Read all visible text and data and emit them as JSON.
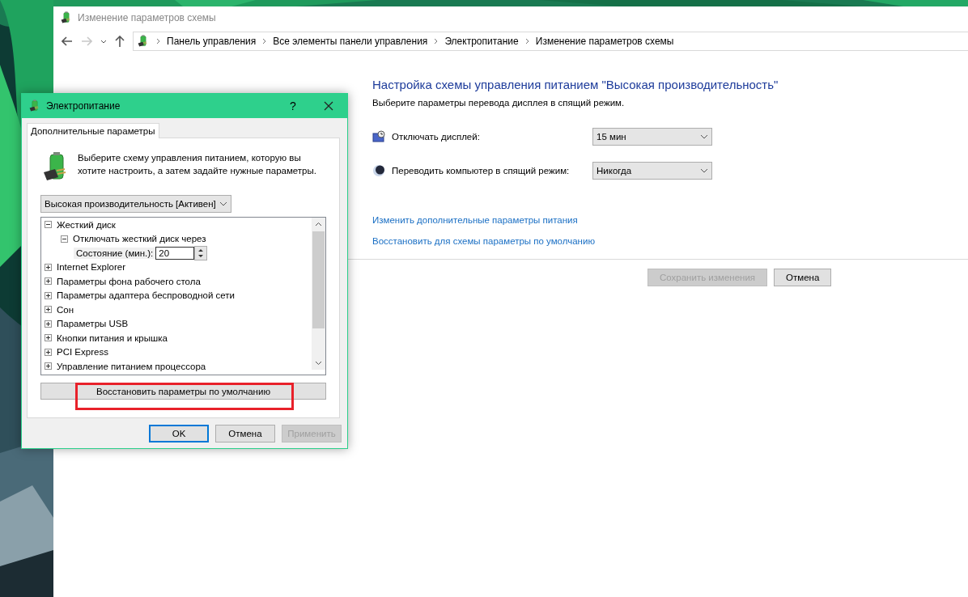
{
  "window": {
    "title": "Изменение параметров схемы"
  },
  "nav": [
    {
      "kind": "back",
      "disabled": false
    },
    {
      "kind": "forward",
      "disabled": true
    },
    {
      "kind": "recent",
      "disabled": false
    },
    {
      "kind": "up",
      "disabled": false
    }
  ],
  "breadcrumb": [
    "Панель управления",
    "Все элементы панели управления",
    "Электропитание",
    "Изменение параметров схемы"
  ],
  "plan": {
    "heading": "Настройка схемы управления питанием \"Высокая производительность\"",
    "subheading": "Выберите параметры перевода дисплея в спящий режим.",
    "settings": [
      {
        "kind": "display",
        "label": "Отключать дисплей:",
        "value": "15 мин"
      },
      {
        "kind": "sleep",
        "label": "Переводить компьютер в спящий режим:",
        "value": "Никогда"
      }
    ],
    "links": [
      "Изменить дополнительные параметры питания",
      "Восстановить для схемы параметры по умолчанию"
    ],
    "buttons": [
      {
        "label": "Сохранить изменения",
        "disabled": true
      },
      {
        "label": "Отмена",
        "disabled": false
      }
    ]
  },
  "dialog": {
    "title": "Электропитание",
    "help": "?",
    "tabs": [
      {
        "label": "Дополнительные параметры",
        "selected": true
      }
    ],
    "intro": "Выберите схему управления питанием, которую вы хотите настроить, а затем задайте нужные параметры.",
    "scheme": "Высокая производительность [Активен]",
    "tree": [
      {
        "label": "Жесткий диск",
        "expanded": true,
        "children": [
          {
            "label": "Отключать жесткий диск через",
            "expanded": true,
            "children": [
              {
                "kind": "setting",
                "label": "Состояние (мин.):",
                "value": "20"
              }
            ]
          }
        ]
      },
      {
        "label": "Internet Explorer",
        "expanded": false
      },
      {
        "label": "Параметры фона рабочего стола",
        "expanded": false
      },
      {
        "label": "Параметры адаптера беспроводной сети",
        "expanded": false
      },
      {
        "label": "Сон",
        "expanded": false
      },
      {
        "label": "Параметры USB",
        "expanded": false
      },
      {
        "label": "Кнопки питания и крышка",
        "expanded": false
      },
      {
        "label": "PCI Express",
        "expanded": false
      },
      {
        "label": "Управление питанием процессора",
        "expanded": false
      }
    ],
    "restore": {
      "label": "Восстановить параметры по умолчанию",
      "highlighted": true
    },
    "buttons": [
      {
        "label": "OK",
        "default": true,
        "disabled": false
      },
      {
        "label": "Отмена",
        "default": false,
        "disabled": false
      },
      {
        "label": "Применить",
        "default": false,
        "disabled": true
      }
    ]
  }
}
